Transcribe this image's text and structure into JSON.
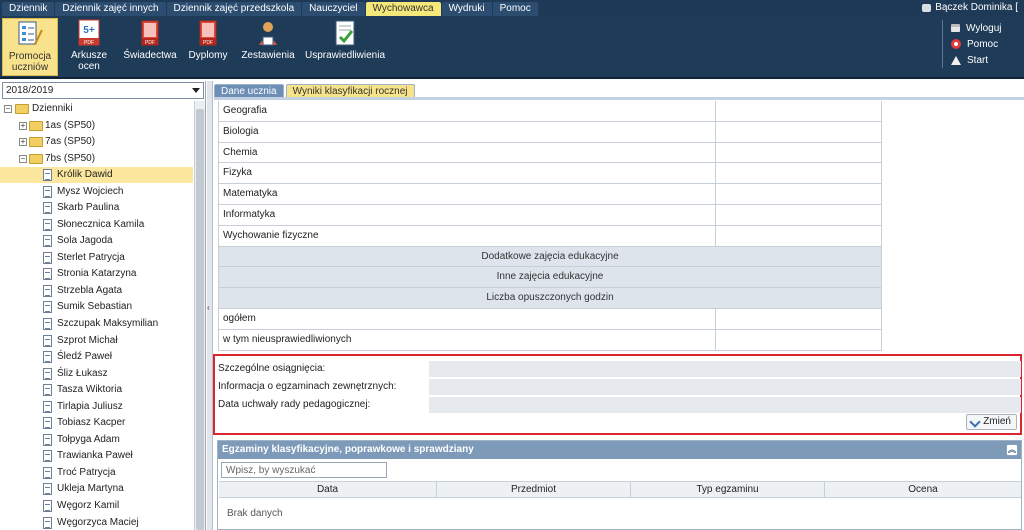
{
  "menu": {
    "tabs": [
      {
        "label": "Dziennik"
      },
      {
        "label": "Dziennik zajęć innych"
      },
      {
        "label": "Dziennik zajęć przedszkola"
      },
      {
        "label": "Nauczyciel"
      },
      {
        "label": "Wychowawca"
      },
      {
        "label": "Wydruki"
      },
      {
        "label": "Pomoc"
      }
    ],
    "active_tab": "Wychowawca",
    "user": "Bączek Dominika ["
  },
  "toolbar": {
    "buttons": [
      {
        "label": "Promocja uczniów",
        "icon": "promotion-icon"
      },
      {
        "label": "Arkusze ocen",
        "icon": "grade-sheets-icon",
        "badge": "5+"
      },
      {
        "label": "Świadectwa",
        "icon": "certificate-pdf-icon",
        "badge": "PDF"
      },
      {
        "label": "Dyplomy",
        "icon": "diploma-pdf-icon",
        "badge": "PDF"
      },
      {
        "label": "Zestawienia",
        "icon": "reports-icon"
      },
      {
        "label": "Usprawiedliwienia",
        "icon": "excuses-icon"
      }
    ],
    "active_button": "Promocja uczniów",
    "side": [
      {
        "label": "Wyloguj",
        "icon": "lock-icon"
      },
      {
        "label": "Pomoc",
        "icon": "lifebuoy-icon"
      },
      {
        "label": "Start",
        "icon": "home-icon"
      }
    ]
  },
  "left": {
    "year": "2018/2019",
    "tree": {
      "root": "Dzienniki",
      "classes": [
        "1as (SP50)",
        "7as (SP50)",
        "7bs (SP50)"
      ],
      "students": [
        "Królik Dawid",
        "Mysz Wojciech",
        "Skarb Paulina",
        "Słonecznica Kamila",
        "Sola Jagoda",
        "Sterlet Patrycja",
        "Stronia Katarzyna",
        "Strzebla Agata",
        "Sumik Sebastian",
        "Szczupak Maksymilian",
        "Szprot Michał",
        "Śledź Paweł",
        "Śliz Łukasz",
        "Tasza Wiktoria",
        "Tirlapia Juliusz",
        "Tobiasz Kacper",
        "Tołpyga Adam",
        "Trawianka Paweł",
        "Troć Patrycja",
        "Ukleja Martyna",
        "Węgorz Kamil",
        "Węgorzyca Maciej"
      ],
      "selected_student": "Królik Dawid"
    }
  },
  "content": {
    "tabs": [
      "Dane ucznia",
      "Wyniki klasyfikacji rocznej"
    ],
    "subjects": [
      "Geografia",
      "Biologia",
      "Chemia",
      "Fizyka",
      "Matematyka",
      "Informatyka",
      "Wychowanie fizyczne"
    ],
    "sections": {
      "extra": "Dodatkowe zajęcia edukacyjne",
      "other": "Inne zajęcia edukacyjne",
      "absences": "Liczba opuszczonych godzin"
    },
    "absence_rows": [
      "ogółem",
      "w tym nieusprawiedliwionych"
    ],
    "special": {
      "achievements_label": "Szczególne osiągnięcia:",
      "exams_info_label": "Informacja o egzaminach zewnętrznych:",
      "council_date_label": "Data uchwały rady pedagogicznej:",
      "change_button": "Zmień"
    },
    "exams": {
      "title": "Egzaminy klasyfikacyjne, poprawkowe i sprawdziany",
      "search_placeholder": "Wpisz, by wyszukać",
      "columns": [
        "Data",
        "Przedmiot",
        "Typ egzaminu",
        "Ocena"
      ],
      "empty": "Brak danych"
    }
  },
  "colors": {
    "accent_active": "#f5e87a",
    "dark_bar": "#1e3b58",
    "highlight_border": "#d9262c"
  }
}
